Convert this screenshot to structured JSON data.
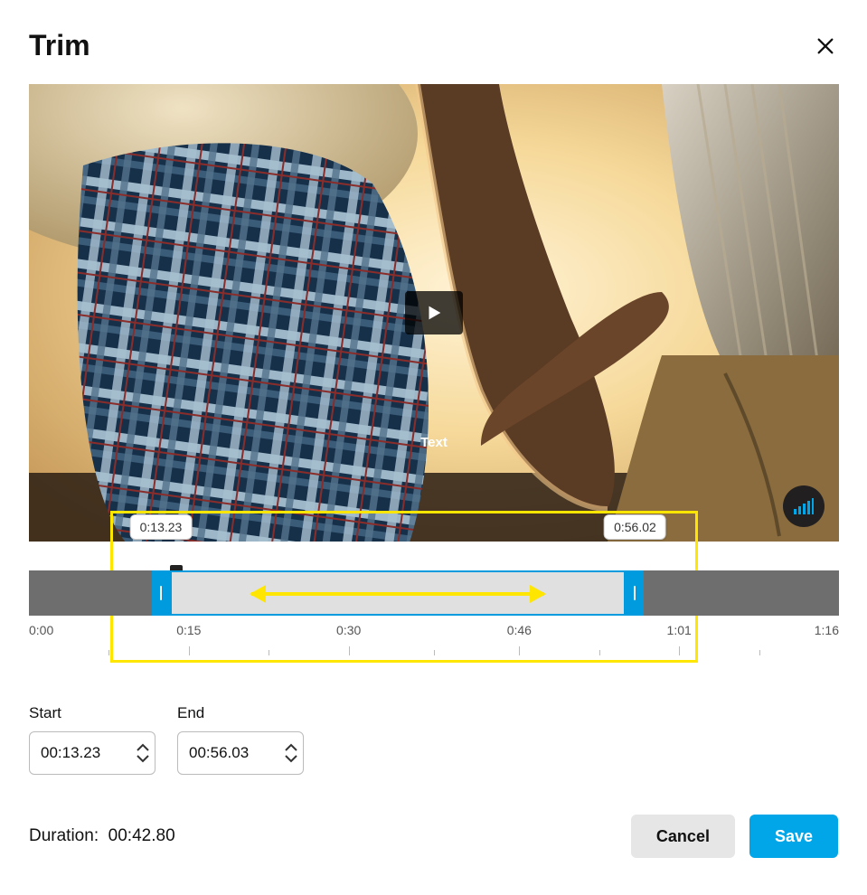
{
  "header": {
    "title": "Trim"
  },
  "video": {
    "overlay_text": "Text"
  },
  "timeline": {
    "total_seconds": 76,
    "start_seconds": 13.23,
    "end_seconds": 56.02,
    "playhead_seconds": 13.8,
    "tooltip_start": "0:13.23",
    "tooltip_end": "0:56.02",
    "ticks": [
      {
        "label": "0:00",
        "seconds": 0,
        "edge": "first"
      },
      {
        "label": "0:15",
        "seconds": 15
      },
      {
        "label": "0:30",
        "seconds": 30
      },
      {
        "label": "0:46",
        "seconds": 46
      },
      {
        "label": "1:01",
        "seconds": 61
      },
      {
        "label": "1:16",
        "seconds": 76,
        "edge": "last"
      }
    ]
  },
  "fields": {
    "start_label": "Start",
    "start_value": "00:13.23",
    "end_label": "End",
    "end_value": "00:56.03"
  },
  "footer": {
    "duration_label": "Duration:",
    "duration_value": "00:42.80",
    "cancel": "Cancel",
    "save": "Save"
  },
  "colors": {
    "accent": "#009adf",
    "highlight": "#ffe600"
  }
}
